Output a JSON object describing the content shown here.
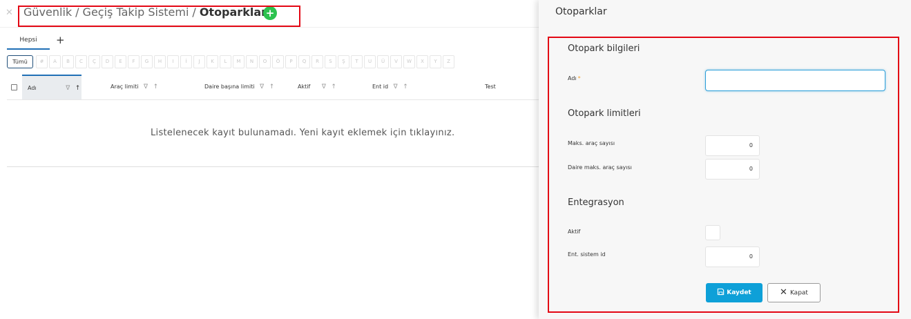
{
  "breadcrumb": {
    "close_icon": "close-icon",
    "items": [
      "Güvenlik",
      "Geçiş Takip Sistemi"
    ],
    "separator": "/",
    "current": "Otoparklar",
    "add_icon": "plus-circle-icon",
    "add_symbol": "+"
  },
  "tabs": {
    "all_label": "Hepsi",
    "add_symbol": "+"
  },
  "alphabet": {
    "all_label": "Tümü",
    "letters": [
      "#",
      "A",
      "B",
      "C",
      "Ç",
      "D",
      "E",
      "F",
      "G",
      "H",
      "I",
      "İ",
      "J",
      "K",
      "L",
      "M",
      "N",
      "O",
      "Ö",
      "P",
      "Q",
      "R",
      "S",
      "Ş",
      "T",
      "U",
      "Ü",
      "V",
      "W",
      "X",
      "Y",
      "Z"
    ]
  },
  "grid": {
    "columns": [
      {
        "label": "Adı",
        "sortable": true,
        "sorted": "asc",
        "filter_icon": "filter-icon",
        "sort_icon": "arrow-up-icon"
      },
      {
        "label": "Araç limiti",
        "sortable": true,
        "filter_icon": "filter-icon",
        "sort_icon": "arrow-up-icon"
      },
      {
        "label": "Daire başına limiti",
        "sortable": true,
        "filter_icon": "filter-icon",
        "sort_icon": "arrow-up-icon"
      },
      {
        "label": "Aktif",
        "sortable": true,
        "filter_icon": "filter-icon",
        "sort_icon": "arrow-up-icon"
      },
      {
        "label": "Ent id",
        "sortable": true,
        "filter_icon": "filter-icon",
        "sort_icon": "arrow-up-icon"
      },
      {
        "label": "Test",
        "sortable": false
      }
    ],
    "filter_glyph": "∇",
    "sort_glyph": "↑",
    "empty_message": "Listelenecek kayıt bulunamadı. Yeni kayıt eklemek için tıklayınız."
  },
  "drawer": {
    "title": "Otoparklar",
    "sections": {
      "info": "Otopark bilgileri",
      "limits": "Otopark limitleri",
      "integration": "Entegrasyon"
    },
    "fields": {
      "name_label": "Adı",
      "name_required": "*",
      "name_value": "",
      "max_vehicle_label": "Maks. araç sayısı",
      "max_vehicle_value": "0",
      "unit_max_vehicle_label": "Daire maks. araç sayısı",
      "unit_max_vehicle_value": "0",
      "active_label": "Aktif",
      "active_checked": false,
      "ent_system_label": "Ent. sistem id",
      "ent_system_value": "0"
    },
    "buttons": {
      "save_label": "Kaydet",
      "save_icon": "floppy-disk-icon",
      "close_label": "Kapat",
      "close_icon": "close-icon",
      "close_glyph": "✕"
    }
  },
  "colors": {
    "highlight_border": "#e30613",
    "accent": "#0ea0d8",
    "add_button": "#2dc24f",
    "required_star": "#f0a030"
  }
}
